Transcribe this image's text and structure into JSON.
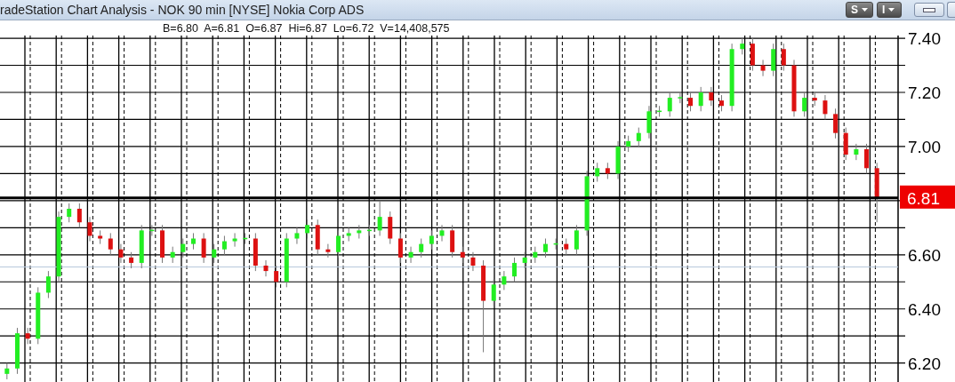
{
  "window": {
    "title": "radeStation Chart Analysis - NOK 90 min [NYSE] Nokia Corp ADS"
  },
  "toolbar": [
    {
      "label": "S"
    },
    {
      "label": "I"
    }
  ],
  "quote_line": "B=6.80  A=6.81  O=6.87  Hi=6.87  Lo=6.72  V=14,408,575",
  "chart": {
    "chart_data": {
      "type": "candlestick",
      "ylim": [
        6.13,
        7.41
      ],
      "grid": true,
      "yticks": [
        {
          "value": 6.2,
          "label": "6.20"
        },
        {
          "value": 6.4,
          "label": "6.40"
        },
        {
          "value": 6.6,
          "label": "6.60"
        },
        {
          "value": 7.0,
          "label": "7.00"
        },
        {
          "value": 7.2,
          "label": "7.20"
        },
        {
          "value": 7.4,
          "label": "7.40"
        }
      ],
      "ohlc": [
        [
          6.16,
          6.2,
          6.14,
          6.18
        ],
        [
          6.18,
          6.33,
          6.16,
          6.31
        ],
        [
          6.31,
          6.33,
          6.27,
          6.29
        ],
        [
          6.29,
          6.48,
          6.27,
          6.46
        ],
        [
          6.46,
          6.54,
          6.44,
          6.52
        ],
        [
          6.52,
          6.76,
          6.5,
          6.74
        ],
        [
          6.74,
          6.79,
          6.72,
          6.77
        ],
        [
          6.77,
          6.79,
          6.7,
          6.72
        ],
        [
          6.72,
          6.74,
          6.65,
          6.67
        ],
        [
          6.67,
          6.69,
          6.64,
          6.66
        ],
        [
          6.66,
          6.68,
          6.6,
          6.62
        ],
        [
          6.62,
          6.64,
          6.57,
          6.59
        ],
        [
          6.59,
          6.61,
          6.55,
          6.57
        ],
        [
          6.57,
          6.71,
          6.55,
          6.69
        ],
        [
          6.69,
          6.71,
          6.67,
          6.69
        ],
        [
          6.69,
          6.71,
          6.57,
          6.59
        ],
        [
          6.59,
          6.63,
          6.57,
          6.61
        ],
        [
          6.61,
          6.66,
          6.59,
          6.64
        ],
        [
          6.64,
          6.68,
          6.62,
          6.66
        ],
        [
          6.66,
          6.68,
          6.57,
          6.59
        ],
        [
          6.59,
          6.64,
          6.57,
          6.62
        ],
        [
          6.62,
          6.67,
          6.6,
          6.65
        ],
        [
          6.65,
          6.68,
          6.63,
          6.66
        ],
        [
          6.66,
          6.68,
          6.64,
          6.66
        ],
        [
          6.66,
          6.68,
          6.54,
          6.56
        ],
        [
          6.56,
          6.58,
          6.52,
          6.54
        ],
        [
          6.54,
          6.56,
          6.48,
          6.5
        ],
        [
          6.5,
          6.68,
          6.48,
          6.66
        ],
        [
          6.66,
          6.7,
          6.64,
          6.68
        ],
        [
          6.68,
          6.73,
          6.66,
          6.71
        ],
        [
          6.71,
          6.73,
          6.6,
          6.62
        ],
        [
          6.62,
          6.64,
          6.59,
          6.61
        ],
        [
          6.61,
          6.69,
          6.59,
          6.67
        ],
        [
          6.67,
          6.7,
          6.65,
          6.68
        ],
        [
          6.68,
          6.71,
          6.66,
          6.69
        ],
        [
          6.69,
          6.71,
          6.67,
          6.69
        ],
        [
          6.69,
          6.8,
          6.67,
          6.74
        ],
        [
          6.74,
          6.76,
          6.64,
          6.66
        ],
        [
          6.66,
          6.68,
          6.57,
          6.59
        ],
        [
          6.59,
          6.63,
          6.57,
          6.61
        ],
        [
          6.61,
          6.66,
          6.59,
          6.64
        ],
        [
          6.64,
          6.69,
          6.62,
          6.67
        ],
        [
          6.67,
          6.71,
          6.65,
          6.69
        ],
        [
          6.69,
          6.71,
          6.59,
          6.61
        ],
        [
          6.61,
          6.63,
          6.57,
          6.59
        ],
        [
          6.59,
          6.61,
          6.54,
          6.56
        ],
        [
          6.56,
          6.58,
          6.24,
          6.43
        ],
        [
          6.43,
          6.51,
          6.41,
          6.49
        ],
        [
          6.49,
          6.54,
          6.47,
          6.52
        ],
        [
          6.52,
          6.59,
          6.5,
          6.57
        ],
        [
          6.57,
          6.61,
          6.55,
          6.59
        ],
        [
          6.59,
          6.63,
          6.57,
          6.61
        ],
        [
          6.61,
          6.66,
          6.59,
          6.64
        ],
        [
          6.64,
          6.66,
          6.62,
          6.64
        ],
        [
          6.64,
          6.66,
          6.6,
          6.62
        ],
        [
          6.62,
          6.71,
          6.6,
          6.69
        ],
        [
          6.69,
          6.91,
          6.67,
          6.89
        ],
        [
          6.89,
          6.94,
          6.87,
          6.92
        ],
        [
          6.92,
          6.94,
          6.88,
          6.9
        ],
        [
          6.9,
          7.02,
          6.88,
          7.0
        ],
        [
          7.0,
          7.04,
          6.98,
          7.02
        ],
        [
          7.02,
          7.07,
          7.0,
          7.05
        ],
        [
          7.05,
          7.15,
          7.03,
          7.13
        ],
        [
          7.13,
          7.15,
          7.11,
          7.13
        ],
        [
          7.13,
          7.2,
          7.11,
          7.18
        ],
        [
          7.18,
          7.2,
          7.16,
          7.18
        ],
        [
          7.18,
          7.2,
          7.13,
          7.15
        ],
        [
          7.15,
          7.22,
          7.13,
          7.2
        ],
        [
          7.2,
          7.22,
          7.15,
          7.17
        ],
        [
          7.17,
          7.19,
          7.13,
          7.15
        ],
        [
          7.15,
          7.38,
          7.13,
          7.36
        ],
        [
          7.36,
          7.4,
          7.34,
          7.38
        ],
        [
          7.38,
          7.4,
          7.28,
          7.3
        ],
        [
          7.3,
          7.32,
          7.26,
          7.28
        ],
        [
          7.28,
          7.38,
          7.26,
          7.36
        ],
        [
          7.36,
          7.38,
          7.28,
          7.3
        ],
        [
          7.3,
          7.32,
          7.11,
          7.13
        ],
        [
          7.13,
          7.2,
          7.11,
          7.18
        ],
        [
          7.18,
          7.2,
          7.15,
          7.17
        ],
        [
          7.17,
          7.19,
          7.1,
          7.12
        ],
        [
          7.12,
          7.14,
          7.03,
          7.05
        ],
        [
          7.05,
          7.07,
          6.95,
          6.97
        ],
        [
          6.97,
          7.01,
          6.95,
          6.99
        ],
        [
          6.99,
          7.01,
          6.9,
          6.92
        ],
        [
          6.92,
          6.94,
          6.72,
          6.81
        ]
      ],
      "ref_lines": [
        {
          "axis": "y",
          "value": 6.555,
          "color": "#b8c8dc"
        },
        {
          "axis": "y",
          "value": 6.81,
          "label": "6.81",
          "color": "#000000"
        }
      ]
    }
  }
}
